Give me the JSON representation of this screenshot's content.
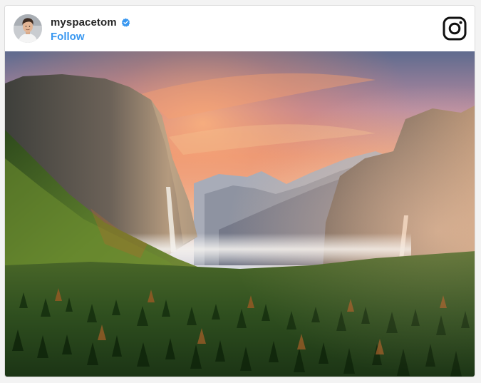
{
  "post": {
    "username": "myspacetom",
    "verified": true,
    "follow_label": "Follow"
  },
  "icons": {
    "verified": "verified-badge-icon",
    "brand": "instagram-icon",
    "avatar": "profile-photo"
  },
  "colors": {
    "link_blue": "#3897f0",
    "verified_blue": "#3897f0",
    "username_text": "#262626",
    "border": "#dbdbdb"
  },
  "photo": {
    "subject": "Yosemite valley sunset landscape with cliffs, waterfalls and forest"
  }
}
